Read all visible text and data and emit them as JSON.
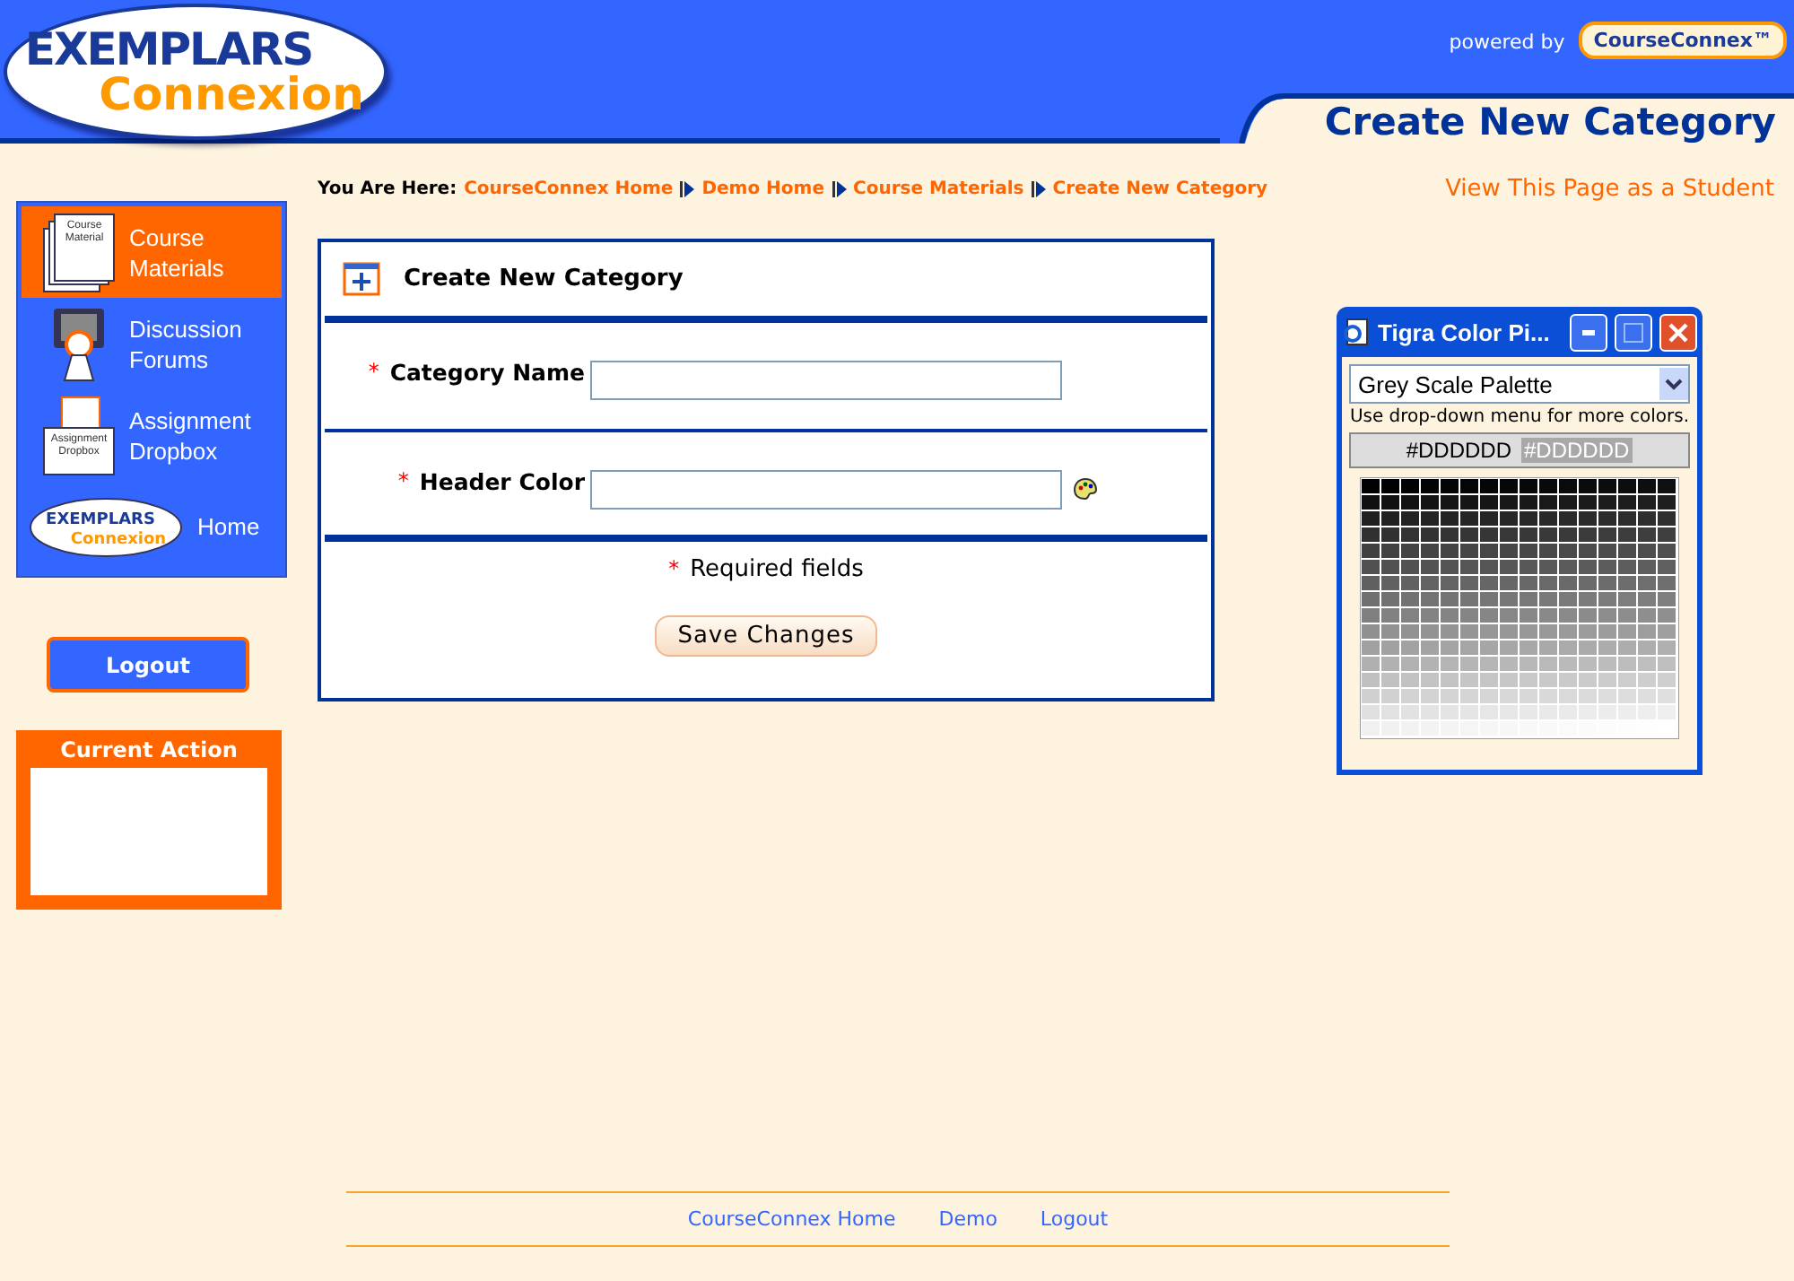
{
  "header": {
    "logo": {
      "line1": "EXEMPLARS",
      "line2": "Connexion"
    },
    "powered_by": "powered by",
    "partner_badge": "CourseConnex™",
    "page_title": "Create New Category"
  },
  "breadcrumb": {
    "label": "You Are Here:",
    "items": [
      "CourseConnex Home",
      "Demo Home",
      "Course Materials",
      "Create New Category"
    ]
  },
  "student_view_link": "View This Page as a Student",
  "sidebar": {
    "items": [
      {
        "kind": "materials",
        "label": "Course Materials",
        "icon_text": "Course Material",
        "selected": true
      },
      {
        "kind": "forums",
        "label": "Discussion Forums",
        "selected": false
      },
      {
        "kind": "dropbox",
        "label": "Assignment Dropbox",
        "icon_text": "Assignment Dropbox",
        "selected": false
      },
      {
        "kind": "logo",
        "label": "Home",
        "logo": {
          "line1": "EXEMPLARS",
          "line2": "Connexion"
        },
        "selected": false
      }
    ]
  },
  "logout_button": "Logout",
  "current_action": {
    "title": "Current Action"
  },
  "form": {
    "title": "Create New Category",
    "required_mark": "*",
    "fields": [
      {
        "kind": "text",
        "label": "Category Name",
        "required": true
      },
      {
        "kind": "color",
        "label": "Header Color",
        "required": true
      }
    ],
    "required_note": "Required fields",
    "save_button": "Save Changes"
  },
  "color_picker": {
    "title": "Tigra Color Pi...",
    "palette_select": "Grey Scale Palette",
    "hint": "Use drop-down menu for more colors.",
    "preview_dark": "#DDDDDD",
    "preview_light": "#DDDDDD"
  },
  "footer": {
    "links": [
      "CourseConnex Home",
      "Demo",
      "Logout"
    ]
  }
}
